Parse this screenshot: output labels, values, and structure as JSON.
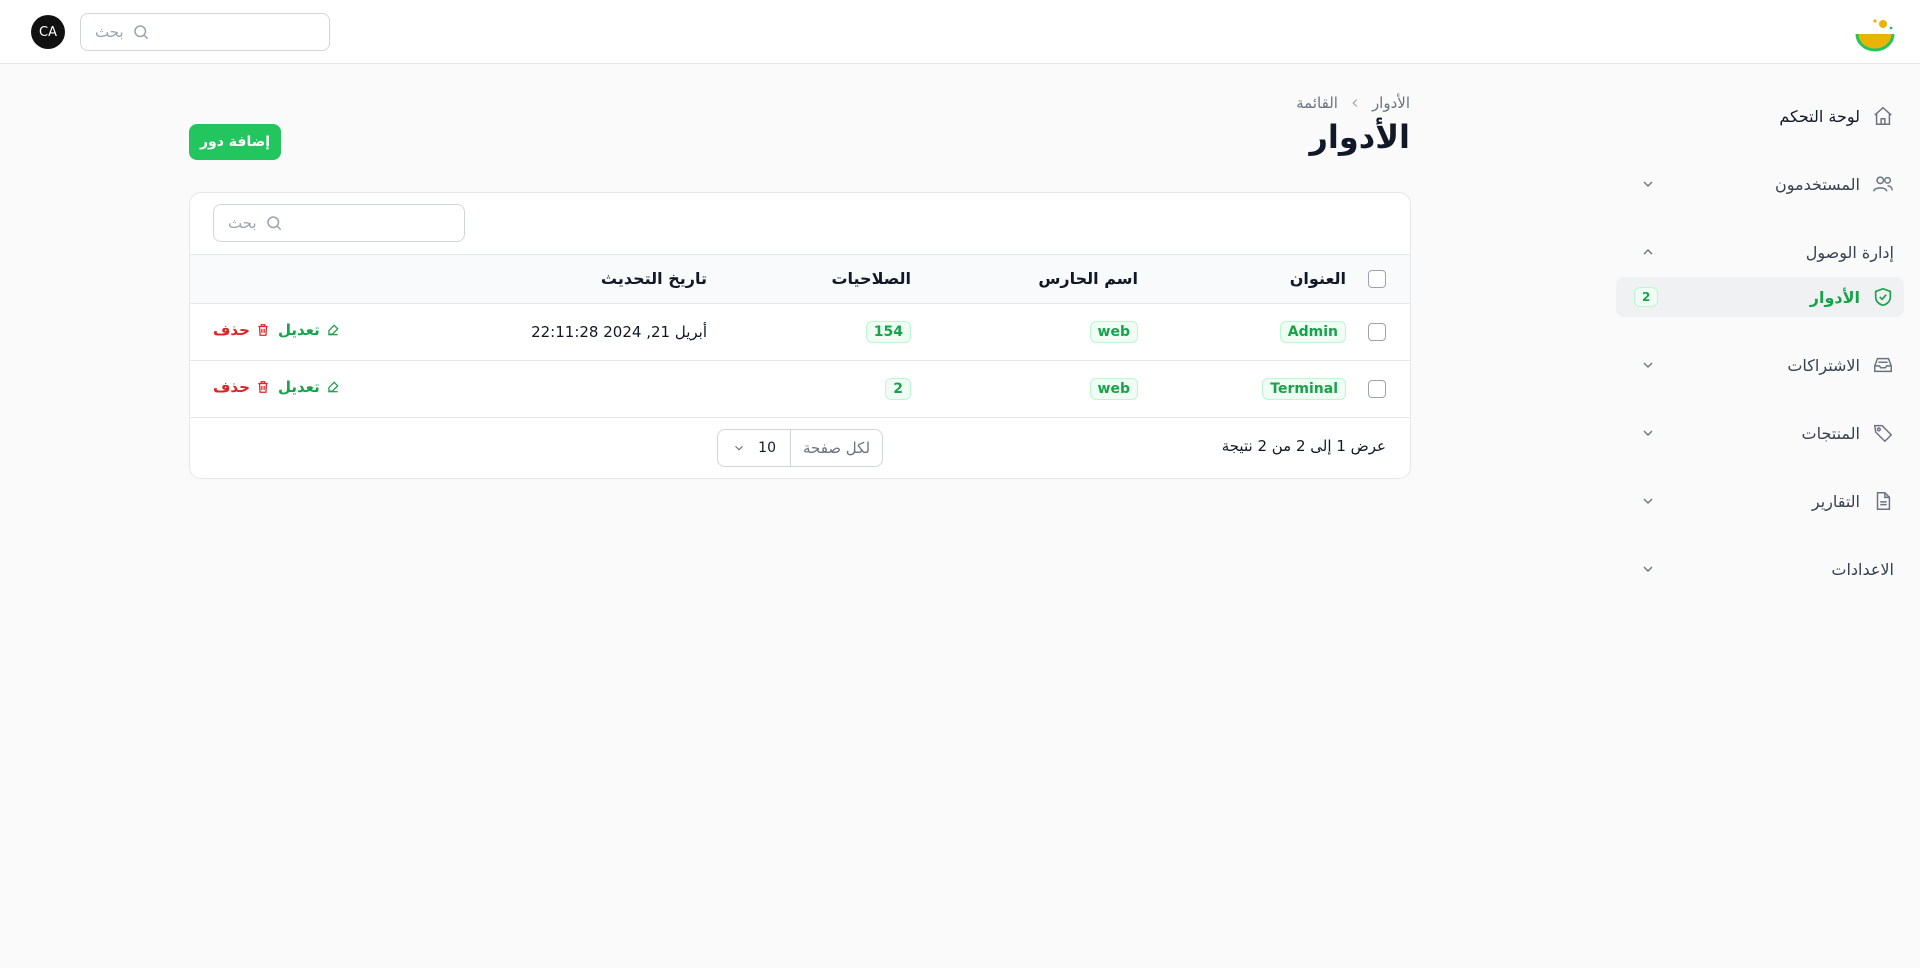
{
  "topbar": {
    "avatar_initials": "CA",
    "search_placeholder": "بحث"
  },
  "sidebar": {
    "dashboard": "لوحة التحكم",
    "users": "المستخدمون",
    "access_group": "إدارة الوصول",
    "roles": "الأدوار",
    "roles_count": "2",
    "subscriptions": "الاشتراكات",
    "products": "المنتجات",
    "reports": "التقارير",
    "settings": "الاعدادات"
  },
  "breadcrumb": {
    "parent": "الأدوار",
    "current": "القائمة"
  },
  "page": {
    "title": "الأدوار",
    "add_button": "إضافة دور"
  },
  "table": {
    "search_placeholder": "بحث",
    "columns": {
      "title": "العنوان",
      "guard": "اسم الحارس",
      "permissions": "الصلاحيات",
      "updated_at": "تاريخ التحديث"
    },
    "rows": [
      {
        "title": "Admin",
        "guard": "web",
        "permissions": "154",
        "updated_at": "أبريل 21, 2024 22:11:28",
        "edit": "تعديل",
        "delete": "حذف"
      },
      {
        "title": "Terminal",
        "guard": "web",
        "permissions": "2",
        "updated_at": "",
        "edit": "تعديل",
        "delete": "حذف"
      }
    ],
    "footer": {
      "summary": "عرض 1 إلى 2 من 2 نتيجة",
      "per_page_label": "لكل صفحة",
      "per_page_value": "10"
    }
  },
  "colors": {
    "accent": "#22c55e",
    "accent_text": "#16a34a",
    "danger": "#dc2626"
  }
}
